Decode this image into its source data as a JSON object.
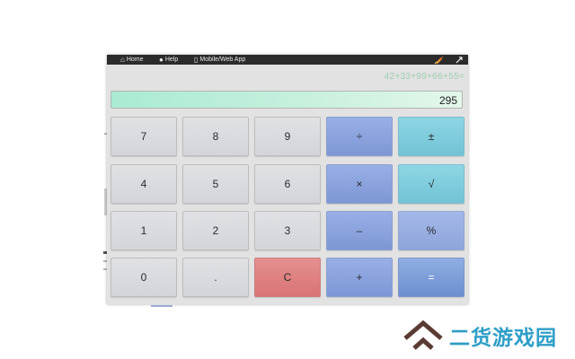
{
  "toolbar": {
    "items": [
      {
        "label": "Home",
        "icon": "home-icon"
      },
      {
        "label": "Help",
        "icon": "info-icon"
      },
      {
        "label": "Mobile/Web App",
        "icon": "mobile-icon"
      }
    ],
    "right_icons": [
      "rocket-icon",
      "expand-icon"
    ]
  },
  "history": "42+33+99+66+55=",
  "display": "295",
  "keys": [
    {
      "label": "7",
      "kind": "num"
    },
    {
      "label": "8",
      "kind": "num"
    },
    {
      "label": "9",
      "kind": "num"
    },
    {
      "label": "÷",
      "kind": "op"
    },
    {
      "label": "±",
      "kind": "fn"
    },
    {
      "label": "4",
      "kind": "num"
    },
    {
      "label": "5",
      "kind": "num"
    },
    {
      "label": "6",
      "kind": "num"
    },
    {
      "label": "×",
      "kind": "op"
    },
    {
      "label": "√",
      "kind": "fn"
    },
    {
      "label": "1",
      "kind": "num"
    },
    {
      "label": "2",
      "kind": "num"
    },
    {
      "label": "3",
      "kind": "num"
    },
    {
      "label": "–",
      "kind": "op"
    },
    {
      "label": "%",
      "kind": "pct"
    },
    {
      "label": "0",
      "kind": "num"
    },
    {
      "label": ".",
      "kind": "num"
    },
    {
      "label": "C",
      "kind": "clear"
    },
    {
      "label": "+",
      "kind": "op"
    },
    {
      "label": "=",
      "kind": "eq"
    }
  ],
  "watermark": {
    "text": "二货游戏园",
    "logo": "house-chevron-logo",
    "color": "#2e9ec7",
    "logo_color": "#5a3b34"
  },
  "colors": {
    "toolbar_bg": "#2b2b2b",
    "display_green": "#a9ebd2",
    "history_text": "#9fcfb0",
    "operator_blue": "#7d97d6",
    "function_teal": "#72c3d6",
    "clear_red": "#d97474"
  }
}
